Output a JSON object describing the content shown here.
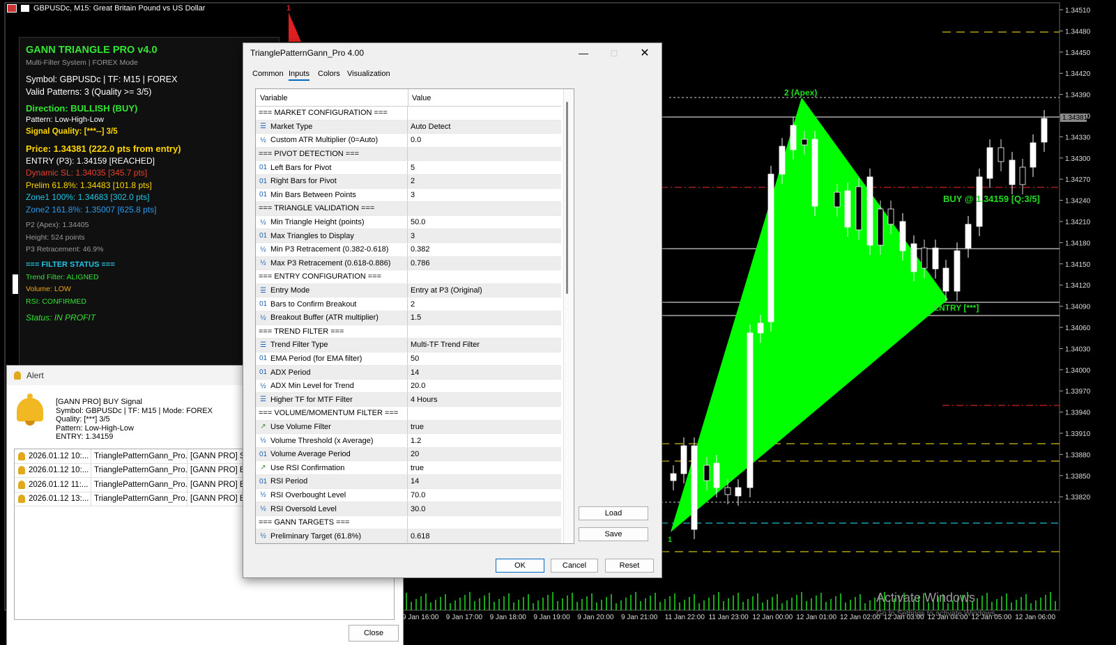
{
  "chart": {
    "title": "GBPUSDc, M15:  Great Britain Pound vs US Dollar",
    "price_axis": [
      "1.34510",
      "1.34480",
      "1.34450",
      "1.34420",
      "1.34390",
      "1.34360",
      "1.34330",
      "1.34300",
      "1.34270",
      "1.34240",
      "1.34210",
      "1.34180",
      "1.34150",
      "1.34120",
      "1.34090",
      "1.34060",
      "1.34030",
      "1.34000",
      "1.33970",
      "1.33940",
      "1.33910",
      "1.33880",
      "1.33850",
      "1.33820"
    ],
    "current_price_tag": "1.34381",
    "time_axis": [
      "9 Jan 16:00",
      "9 Jan 17:00",
      "9 Jan 18:00",
      "9 Jan 19:00",
      "9 Jan 20:00",
      "9 Jan 21:00",
      "11 Jan 22:00",
      "11 Jan 23:00",
      "12 Jan 00:00",
      "12 Jan 01:00",
      "12 Jan 02:00",
      "12 Jan 03:00",
      "12 Jan 04:00",
      "12 Jan 05:00",
      "12 Jan 06:00"
    ],
    "point1_label": "1",
    "apex_label": "2 (Apex)",
    "top_marker": "1",
    "buy_label": "BUY @ 1.34159 [Q:3/5]",
    "entry_label": "ENTRY [***]",
    "watermark_line1": "Activate Windows",
    "watermark_line2": "Go to Settings to activate Windows.",
    "colors": {
      "triangle": "#00ff00",
      "up_candle": "#ffffff",
      "down_candle": "#000000",
      "buy_text": "#22dd22",
      "sl_line": "#cc2222",
      "target_line": "#d4c010",
      "entry_line": "#20c0d0"
    }
  },
  "info_panel": {
    "title": "GANN TRIANGLE PRO v4.0",
    "subtitle": "Multi-Filter System | FOREX Mode",
    "symbol_line": "Symbol: GBPUSDc | TF: M15 | FOREX",
    "valid_patterns": "Valid Patterns: 3 (Quality >= 3/5)",
    "direction": "Direction: BULLISH (BUY)",
    "pattern": "Pattern: Low-High-Low",
    "signal_quality": "Signal Quality: [***--] 3/5",
    "price": "Price: 1.34381 (222.0 pts from entry)",
    "entry": "ENTRY (P3): 1.34159 [REACHED]",
    "dynamic_sl": "Dynamic SL: 1.34035 [345.7 pts]",
    "prelim": "Prelim 61.8%: 1.34483 [101.8 pts]",
    "zone1": "Zone1 100%: 1.34683 [302.0 pts]",
    "zone2": "Zone2 161.8%: 1.35007 [625.8 pts]",
    "p2": "P2 (Apex): 1.34405",
    "height": "Height: 524 points",
    "p3": "P3 Retracement: 46.9%",
    "filter_header": "=== FILTER STATUS ===",
    "trend_filter": "Trend Filter: ALIGNED",
    "volume": "Volume: LOW",
    "rsi": "RSI: CONFIRMED",
    "status": "Status: IN PROFIT"
  },
  "alert": {
    "title": "Alert",
    "message": [
      "[GANN PRO] BUY Signal",
      "Symbol: GBPUSDc | TF: M15 | Mode: FOREX",
      "Quality: [***] 3/5",
      "Pattern: Low-High-Low",
      "ENTRY: 1.34159"
    ],
    "rows": [
      {
        "time": "2026.01.12 10:...",
        "source": "TrianglePatternGann_Pro...",
        "message": "[GANN PRO] SELL"
      },
      {
        "time": "2026.01.12 10:...",
        "source": "TrianglePatternGann_Pro...",
        "message": "[GANN PRO] BUY"
      },
      {
        "time": "2026.01.12 11:...",
        "source": "TrianglePatternGann_Pro...",
        "message": "[GANN PRO] BUY"
      },
      {
        "time": "2026.01.12 13:...",
        "source": "TrianglePatternGann_Pro...",
        "message": "[GANN PRO] BUY"
      }
    ],
    "close_label": "Close"
  },
  "dialog": {
    "title": "TrianglePatternGann_Pro 4.00",
    "tabs": [
      "Common",
      "Inputs",
      "Colors",
      "Visualization"
    ],
    "active_tab": "Inputs",
    "col_variable": "Variable",
    "col_value": "Value",
    "params": [
      {
        "type": "section",
        "name": "=== MARKET CONFIGURATION ===",
        "value": ""
      },
      {
        "type": "enum",
        "name": "Market Type",
        "value": "Auto Detect"
      },
      {
        "type": "double",
        "name": "Custom ATR Multiplier (0=Auto)",
        "value": "0.0"
      },
      {
        "type": "section",
        "name": "=== PIVOT DETECTION ===",
        "value": ""
      },
      {
        "type": "int",
        "name": "Left Bars for Pivot",
        "value": "5"
      },
      {
        "type": "int",
        "name": "Right Bars for Pivot",
        "value": "2"
      },
      {
        "type": "int",
        "name": "Min Bars Between Points",
        "value": "3"
      },
      {
        "type": "section",
        "name": "=== TRIANGLE VALIDATION ===",
        "value": ""
      },
      {
        "type": "double",
        "name": "Min Triangle Height (points)",
        "value": "50.0"
      },
      {
        "type": "int",
        "name": "Max Triangles to Display",
        "value": "3"
      },
      {
        "type": "double",
        "name": "Min P3 Retracement (0.382-0.618)",
        "value": "0.382"
      },
      {
        "type": "double",
        "name": "Max P3 Retracement (0.618-0.886)",
        "value": "0.786"
      },
      {
        "type": "section",
        "name": "=== ENTRY CONFIGURATION ===",
        "value": ""
      },
      {
        "type": "enum",
        "name": "Entry Mode",
        "value": "Entry at P3 (Original)"
      },
      {
        "type": "int",
        "name": "Bars to Confirm Breakout",
        "value": "2"
      },
      {
        "type": "double",
        "name": "Breakout Buffer (ATR multiplier)",
        "value": "1.5"
      },
      {
        "type": "section",
        "name": "=== TREND FILTER ===",
        "value": ""
      },
      {
        "type": "enum",
        "name": "Trend Filter Type",
        "value": "Multi-TF Trend Filter"
      },
      {
        "type": "int",
        "name": "EMA Period (for EMA filter)",
        "value": "50"
      },
      {
        "type": "int",
        "name": "ADX Period",
        "value": "14"
      },
      {
        "type": "double",
        "name": "ADX Min Level for Trend",
        "value": "20.0"
      },
      {
        "type": "enum",
        "name": "Higher TF for MTF Filter",
        "value": "4 Hours"
      },
      {
        "type": "section",
        "name": "=== VOLUME/MOMENTUM FILTER ===",
        "value": ""
      },
      {
        "type": "bool",
        "name": "Use Volume Filter",
        "value": "true"
      },
      {
        "type": "double",
        "name": "Volume Threshold (x Average)",
        "value": "1.2"
      },
      {
        "type": "int",
        "name": "Volume Average Period",
        "value": "20"
      },
      {
        "type": "bool",
        "name": "Use RSI Confirmation",
        "value": "true"
      },
      {
        "type": "int",
        "name": "RSI Period",
        "value": "14"
      },
      {
        "type": "double",
        "name": "RSI Overbought Level",
        "value": "70.0"
      },
      {
        "type": "double",
        "name": "RSI Oversold Level",
        "value": "30.0"
      },
      {
        "type": "section",
        "name": "=== GANN TARGETS ===",
        "value": ""
      },
      {
        "type": "double",
        "name": "Preliminary Target (61.8%)",
        "value": "0.618"
      }
    ],
    "icons": {
      "int": "01",
      "double": "½",
      "enum": "☰",
      "bool": "↗"
    },
    "buttons": {
      "load": "Load",
      "save": "Save",
      "ok": "OK",
      "cancel": "Cancel",
      "reset": "Reset"
    }
  }
}
